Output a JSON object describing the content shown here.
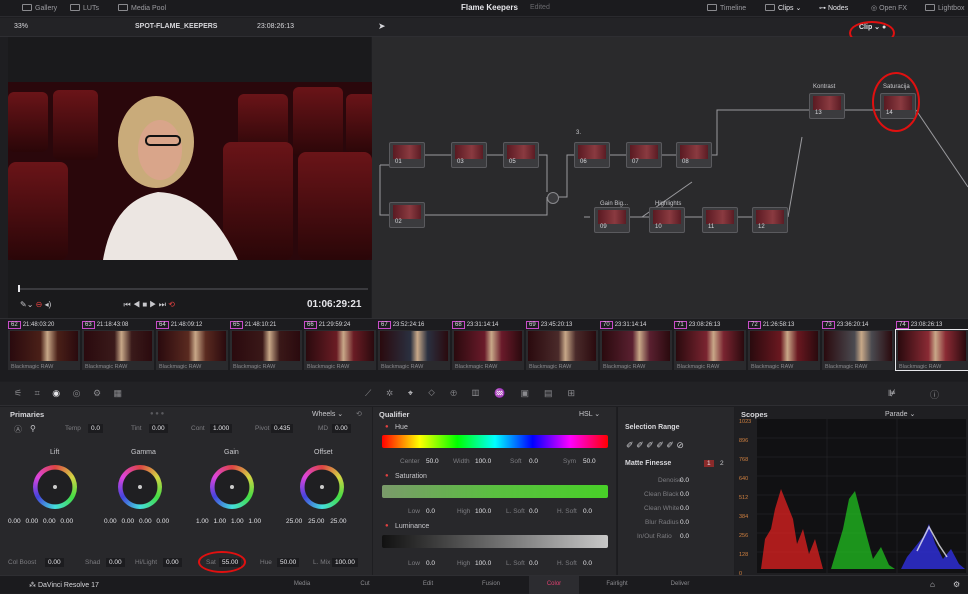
{
  "topbar": {
    "gallery": "Gallery",
    "luts": "LUTs",
    "media_pool": "Media Pool",
    "project": "Flame Keepers",
    "status": "Edited",
    "timeline": "Timeline",
    "clips": "Clips",
    "nodes": "Nodes",
    "openfx": "Open FX",
    "lightbox": "Lightbox"
  },
  "viewer": {
    "zoom": "33%",
    "clip_name": "SPOT-FLAME_KEEPERS",
    "timecode_top": "23:08:26:13",
    "timecode": "01:06:29:21"
  },
  "node_editor": {
    "mode": "Clip",
    "nodes": [
      {
        "id": "01",
        "label": ""
      },
      {
        "id": "03",
        "label": ""
      },
      {
        "id": "05",
        "label": ""
      },
      {
        "id": "02",
        "label": ""
      },
      {
        "id": "06",
        "label": ""
      },
      {
        "id": "07",
        "label": ""
      },
      {
        "id": "08",
        "label": ""
      },
      {
        "id": "09",
        "label": "Gain Big..."
      },
      {
        "id": "10",
        "label": "Highlights"
      },
      {
        "id": "11",
        "label": ""
      },
      {
        "id": "12",
        "label": ""
      },
      {
        "id": "13",
        "label": "Kontrast"
      },
      {
        "id": "14",
        "label": "Saturacija"
      }
    ],
    "extra_label": "3."
  },
  "clips": [
    {
      "num": "62",
      "tc": "21:48:03:20",
      "track": "V2",
      "codec": "Blackmagic RAW"
    },
    {
      "num": "63",
      "tc": "21:18:43:08",
      "track": "V2",
      "codec": "Blackmagic RAW"
    },
    {
      "num": "64",
      "tc": "21:48:09:12",
      "track": "V2",
      "codec": "Blackmagic RAW"
    },
    {
      "num": "65",
      "tc": "21:48:10:21",
      "track": "V2",
      "codec": "Blackmagic RAW"
    },
    {
      "num": "66",
      "tc": "21:29:59:24",
      "track": "V2",
      "codec": "Blackmagic RAW"
    },
    {
      "num": "67",
      "tc": "23:52:24:16",
      "track": "V2",
      "codec": "Blackmagic RAW"
    },
    {
      "num": "68",
      "tc": "23:31:14:14",
      "track": "V2",
      "codec": "Blackmagic RAW"
    },
    {
      "num": "69",
      "tc": "23:45:20:13",
      "track": "V2",
      "codec": "Blackmagic RAW"
    },
    {
      "num": "70",
      "tc": "23:31:14:14",
      "track": "V2",
      "codec": "Blackmagic RAW"
    },
    {
      "num": "71",
      "tc": "23:08:26:13",
      "track": "V2",
      "codec": "Blackmagic RAW"
    },
    {
      "num": "72",
      "tc": "21:26:58:13",
      "track": "V1",
      "codec": "Blackmagic RAW"
    },
    {
      "num": "73",
      "tc": "23:36:20:14",
      "track": "V5",
      "codec": "Blackmagic RAW"
    },
    {
      "num": "74",
      "tc": "23:08:26:13",
      "track": "V5",
      "codec": "Blackmagic RAW"
    }
  ],
  "primaries": {
    "title": "Primaries",
    "mode": "Wheels",
    "temp_label": "Temp",
    "temp": "0.0",
    "tint_label": "Tint",
    "tint": "0.00",
    "cont_label": "Cont",
    "cont": "1.000",
    "pivot_label": "Pivot",
    "pivot": "0.435",
    "md_label": "MD",
    "md": "0.00",
    "wheels": [
      {
        "name": "Lift",
        "vals": [
          "0.00",
          "0.00",
          "0.00",
          "0.00"
        ]
      },
      {
        "name": "Gamma",
        "vals": [
          "0.00",
          "0.00",
          "0.00",
          "0.00"
        ]
      },
      {
        "name": "Gain",
        "vals": [
          "1.00",
          "1.00",
          "1.00",
          "1.00"
        ]
      },
      {
        "name": "Offset",
        "vals": [
          "25.00",
          "25.00",
          "25.00"
        ]
      }
    ],
    "colboost_label": "Col Boost",
    "colboost": "0.00",
    "shad_label": "Shad",
    "shad": "0.00",
    "hilight_label": "Hi/Light",
    "hilight": "0.00",
    "sat_label": "Sat",
    "sat": "55.00",
    "hue_label": "Hue",
    "hue": "50.00",
    "lmix_label": "L. Mix",
    "lmix": "100.00"
  },
  "qualifier": {
    "title": "Qualifier",
    "mode": "HSL",
    "hue": "Hue",
    "center_label": "Center",
    "center": "50.0",
    "width_label": "Width",
    "width": "100.0",
    "soft_label": "Soft",
    "soft": "0.0",
    "sym_label": "Sym",
    "sym": "50.0",
    "saturation": "Saturation",
    "low_label": "Low",
    "low": "0.0",
    "high_label": "High",
    "high": "100.0",
    "lsoft_label": "L. Soft",
    "lsoft": "0.0",
    "hsoft_label": "H. Soft",
    "hsoft": "0.0",
    "luminance": "Luminance",
    "l_low": "0.0",
    "l_high": "100.0",
    "l_lsoft": "0.0",
    "l_hsoft": "0.0"
  },
  "selection": {
    "title": "Selection Range",
    "matte": "Matte Finesse",
    "m1": "1",
    "m2": "2",
    "denoise_label": "Denoise",
    "denoise": "0.0",
    "cleanblack_label": "Clean Black",
    "cleanblack": "0.0",
    "cleanwhite_label": "Clean White",
    "cleanwhite": "0.0",
    "blur_label": "Blur Radius",
    "blur": "0.0",
    "inout_label": "In/Out Ratio",
    "inout": "0.0"
  },
  "scopes": {
    "title": "Scopes",
    "mode": "Parade",
    "ticks": [
      "1023",
      "896",
      "768",
      "640",
      "512",
      "384",
      "256",
      "128",
      "0"
    ]
  },
  "bottom": {
    "app": "DaVinci Resolve 17",
    "pages": [
      "Media",
      "Cut",
      "Edit",
      "Fusion",
      "Color",
      "Fairlight",
      "Deliver"
    ],
    "active": "Color"
  }
}
